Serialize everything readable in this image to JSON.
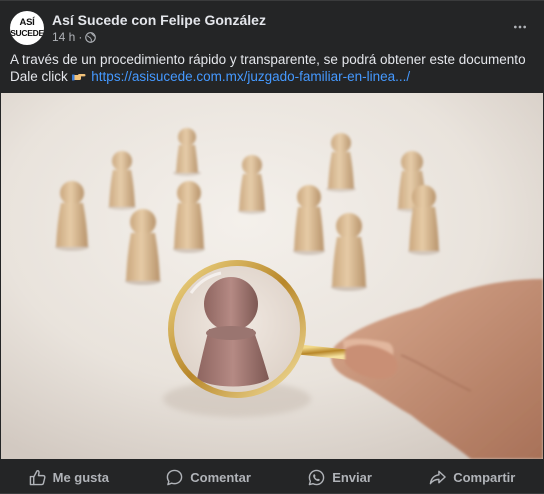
{
  "post": {
    "author": "Así Sucede con Felipe González",
    "avatar_text_line1": "ASÍ",
    "avatar_text_line2": "SUCEDE",
    "time": "14 h",
    "separator": "·",
    "text_line1": "A través de un procedimiento rápido y transparente, se podrá obtener este documento",
    "text_line2_prefix": "Dale click",
    "link": "https://asisucede.com.mx/juzgado-familiar-en-linea.../"
  },
  "photo": {
    "subject": "wooden-figures-magnifying-glass"
  },
  "actions": {
    "like": "Me gusta",
    "comment": "Comentar",
    "send": "Enviar",
    "share": "Compartir"
  },
  "colors": {
    "background": "#242526",
    "text": "#e4e6eb",
    "secondary": "#b0b3b8",
    "link": "#4599ff"
  }
}
